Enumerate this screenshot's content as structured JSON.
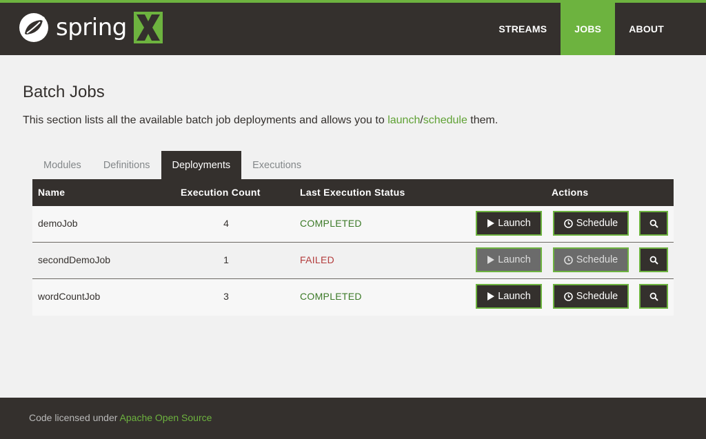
{
  "header": {
    "logo_text": "spring",
    "nav": [
      {
        "label": "STREAMS"
      },
      {
        "label": "JOBS",
        "active": true
      },
      {
        "label": "ABOUT"
      }
    ]
  },
  "page": {
    "title": "Batch Jobs",
    "intro_prefix": "This section lists all the available batch job deployments and allows you to ",
    "intro_link_launch": "launch",
    "intro_sep": "/",
    "intro_link_schedule": "schedule",
    "intro_suffix": " them."
  },
  "tabs": [
    {
      "label": "Modules"
    },
    {
      "label": "Definitions"
    },
    {
      "label": "Deployments",
      "active": true
    },
    {
      "label": "Executions"
    }
  ],
  "table": {
    "columns": {
      "name": "Name",
      "count": "Execution Count",
      "status": "Last Execution Status",
      "actions": "Actions"
    },
    "rows": [
      {
        "name": "demoJob",
        "count": "4",
        "status": "COMPLETED",
        "enabled": true
      },
      {
        "name": "secondDemoJob",
        "count": "1",
        "status": "FAILED",
        "enabled": false
      },
      {
        "name": "wordCountJob",
        "count": "3",
        "status": "COMPLETED",
        "enabled": true
      }
    ],
    "launch_label": "Launch",
    "schedule_label": "Schedule"
  },
  "icons": {
    "launch": "play-icon",
    "schedule": "clock-icon",
    "details": "search-icon"
  },
  "footer": {
    "prefix": "Code licensed under ",
    "link": "Apache Open Source"
  },
  "colors": {
    "brand_green": "#6db33f",
    "dark": "#34302d",
    "completed": "#3c7a28",
    "failed": "#b33b3b"
  }
}
